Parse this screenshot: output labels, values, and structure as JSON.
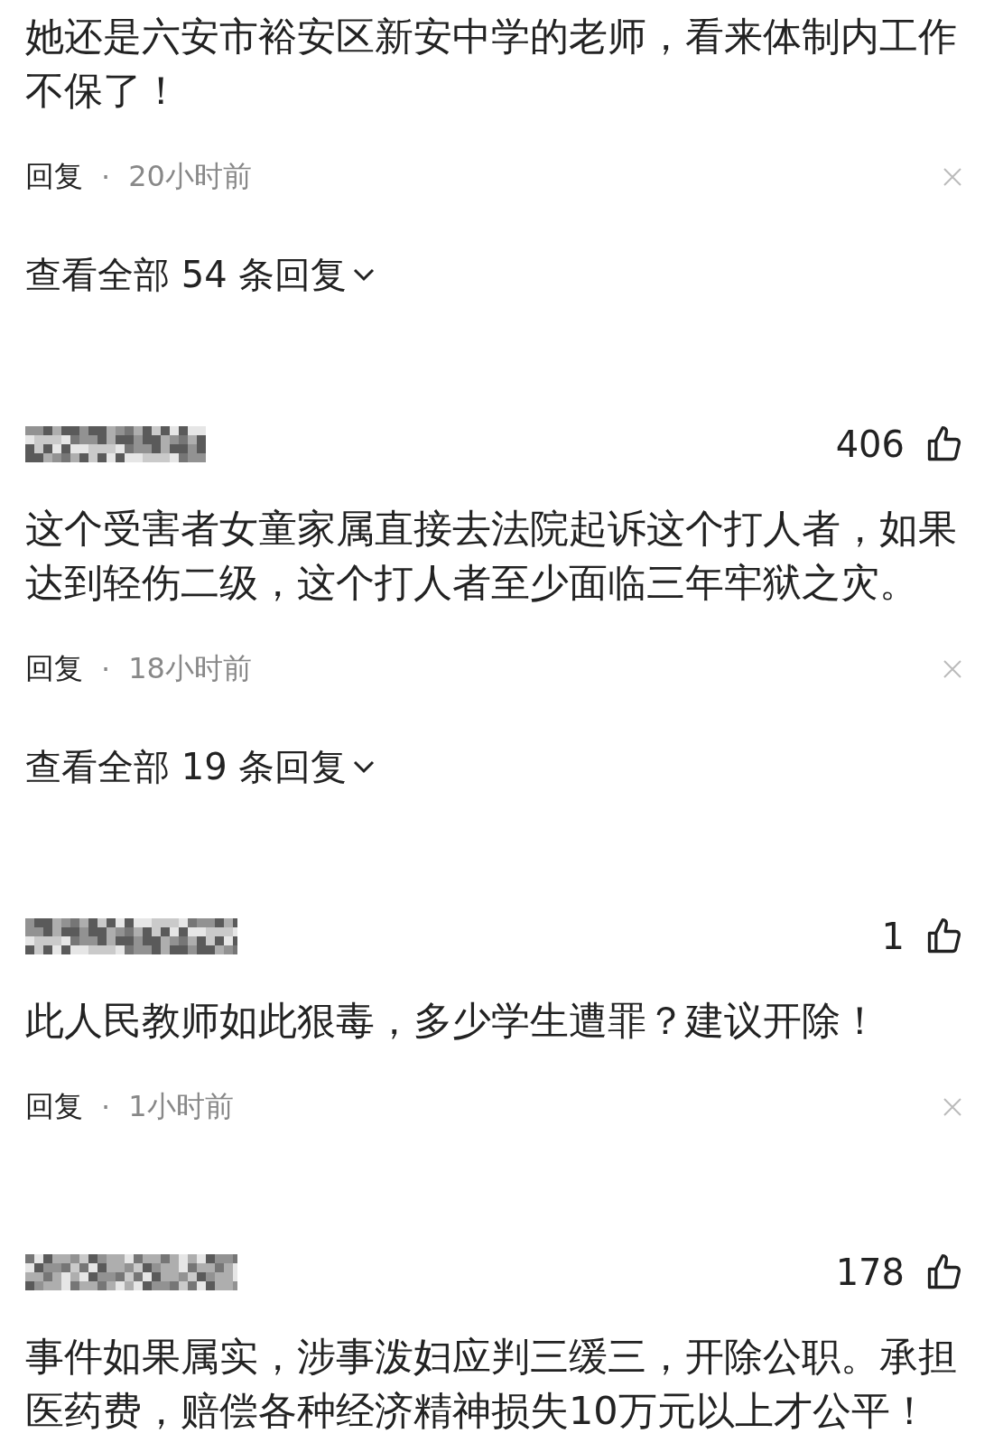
{
  "comments": [
    {
      "text": "她还是六安市裕安区新安中学的老师，看来体制内工作不保了！",
      "reply_label": "回复",
      "separator": "·",
      "time": "20小时前",
      "view_replies": "查看全部 54 条回复"
    },
    {
      "likes": "406",
      "text": "这个受害者女童家属直接去法院起诉这个打人者，如果达到轻伤二级，这个打人者至少面临三年牢狱之灾。",
      "reply_label": "回复",
      "separator": "·",
      "time": "18小时前",
      "view_replies": "查看全部 19 条回复"
    },
    {
      "likes": "1",
      "text": "此人民教师如此狠毒，多少学生遭罪？建议开除！",
      "reply_label": "回复",
      "separator": "·",
      "time": "1小时前"
    },
    {
      "likes": "178",
      "text": "事件如果属实，涉事泼妇应判三缓三，开除公职。承担医药费，赔偿各种经济精神损失10万元以上才公平！"
    }
  ]
}
